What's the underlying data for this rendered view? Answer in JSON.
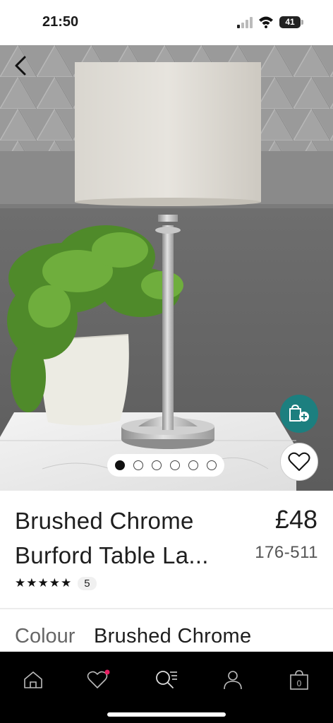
{
  "status_bar": {
    "time": "21:50",
    "battery": "41"
  },
  "hero": {
    "image_alt": "Brushed chrome table lamp with linen shade beside fern plant",
    "slide_count": 6,
    "active_slide": 1
  },
  "product": {
    "title_line1": "Brushed Chrome",
    "title_line2": "Burford Table La...",
    "price": "£48",
    "sku": "176-511",
    "rating_stars": "★★★★★",
    "rating_value": 5,
    "review_count": "5"
  },
  "colour": {
    "label": "Colour",
    "value": "Brushed Chrome"
  },
  "bottom_nav": {
    "items": [
      {
        "name": "home",
        "icon": "home-icon"
      },
      {
        "name": "favourites",
        "icon": "heart-icon",
        "badge": true
      },
      {
        "name": "search",
        "icon": "search-menu-icon"
      },
      {
        "name": "account",
        "icon": "user-icon"
      },
      {
        "name": "bag",
        "icon": "bag-icon",
        "count": "0"
      }
    ]
  },
  "colors": {
    "accent_teal": "#1c7f7f",
    "badge_pink": "#e91e63",
    "nav_bg": "#000000"
  }
}
